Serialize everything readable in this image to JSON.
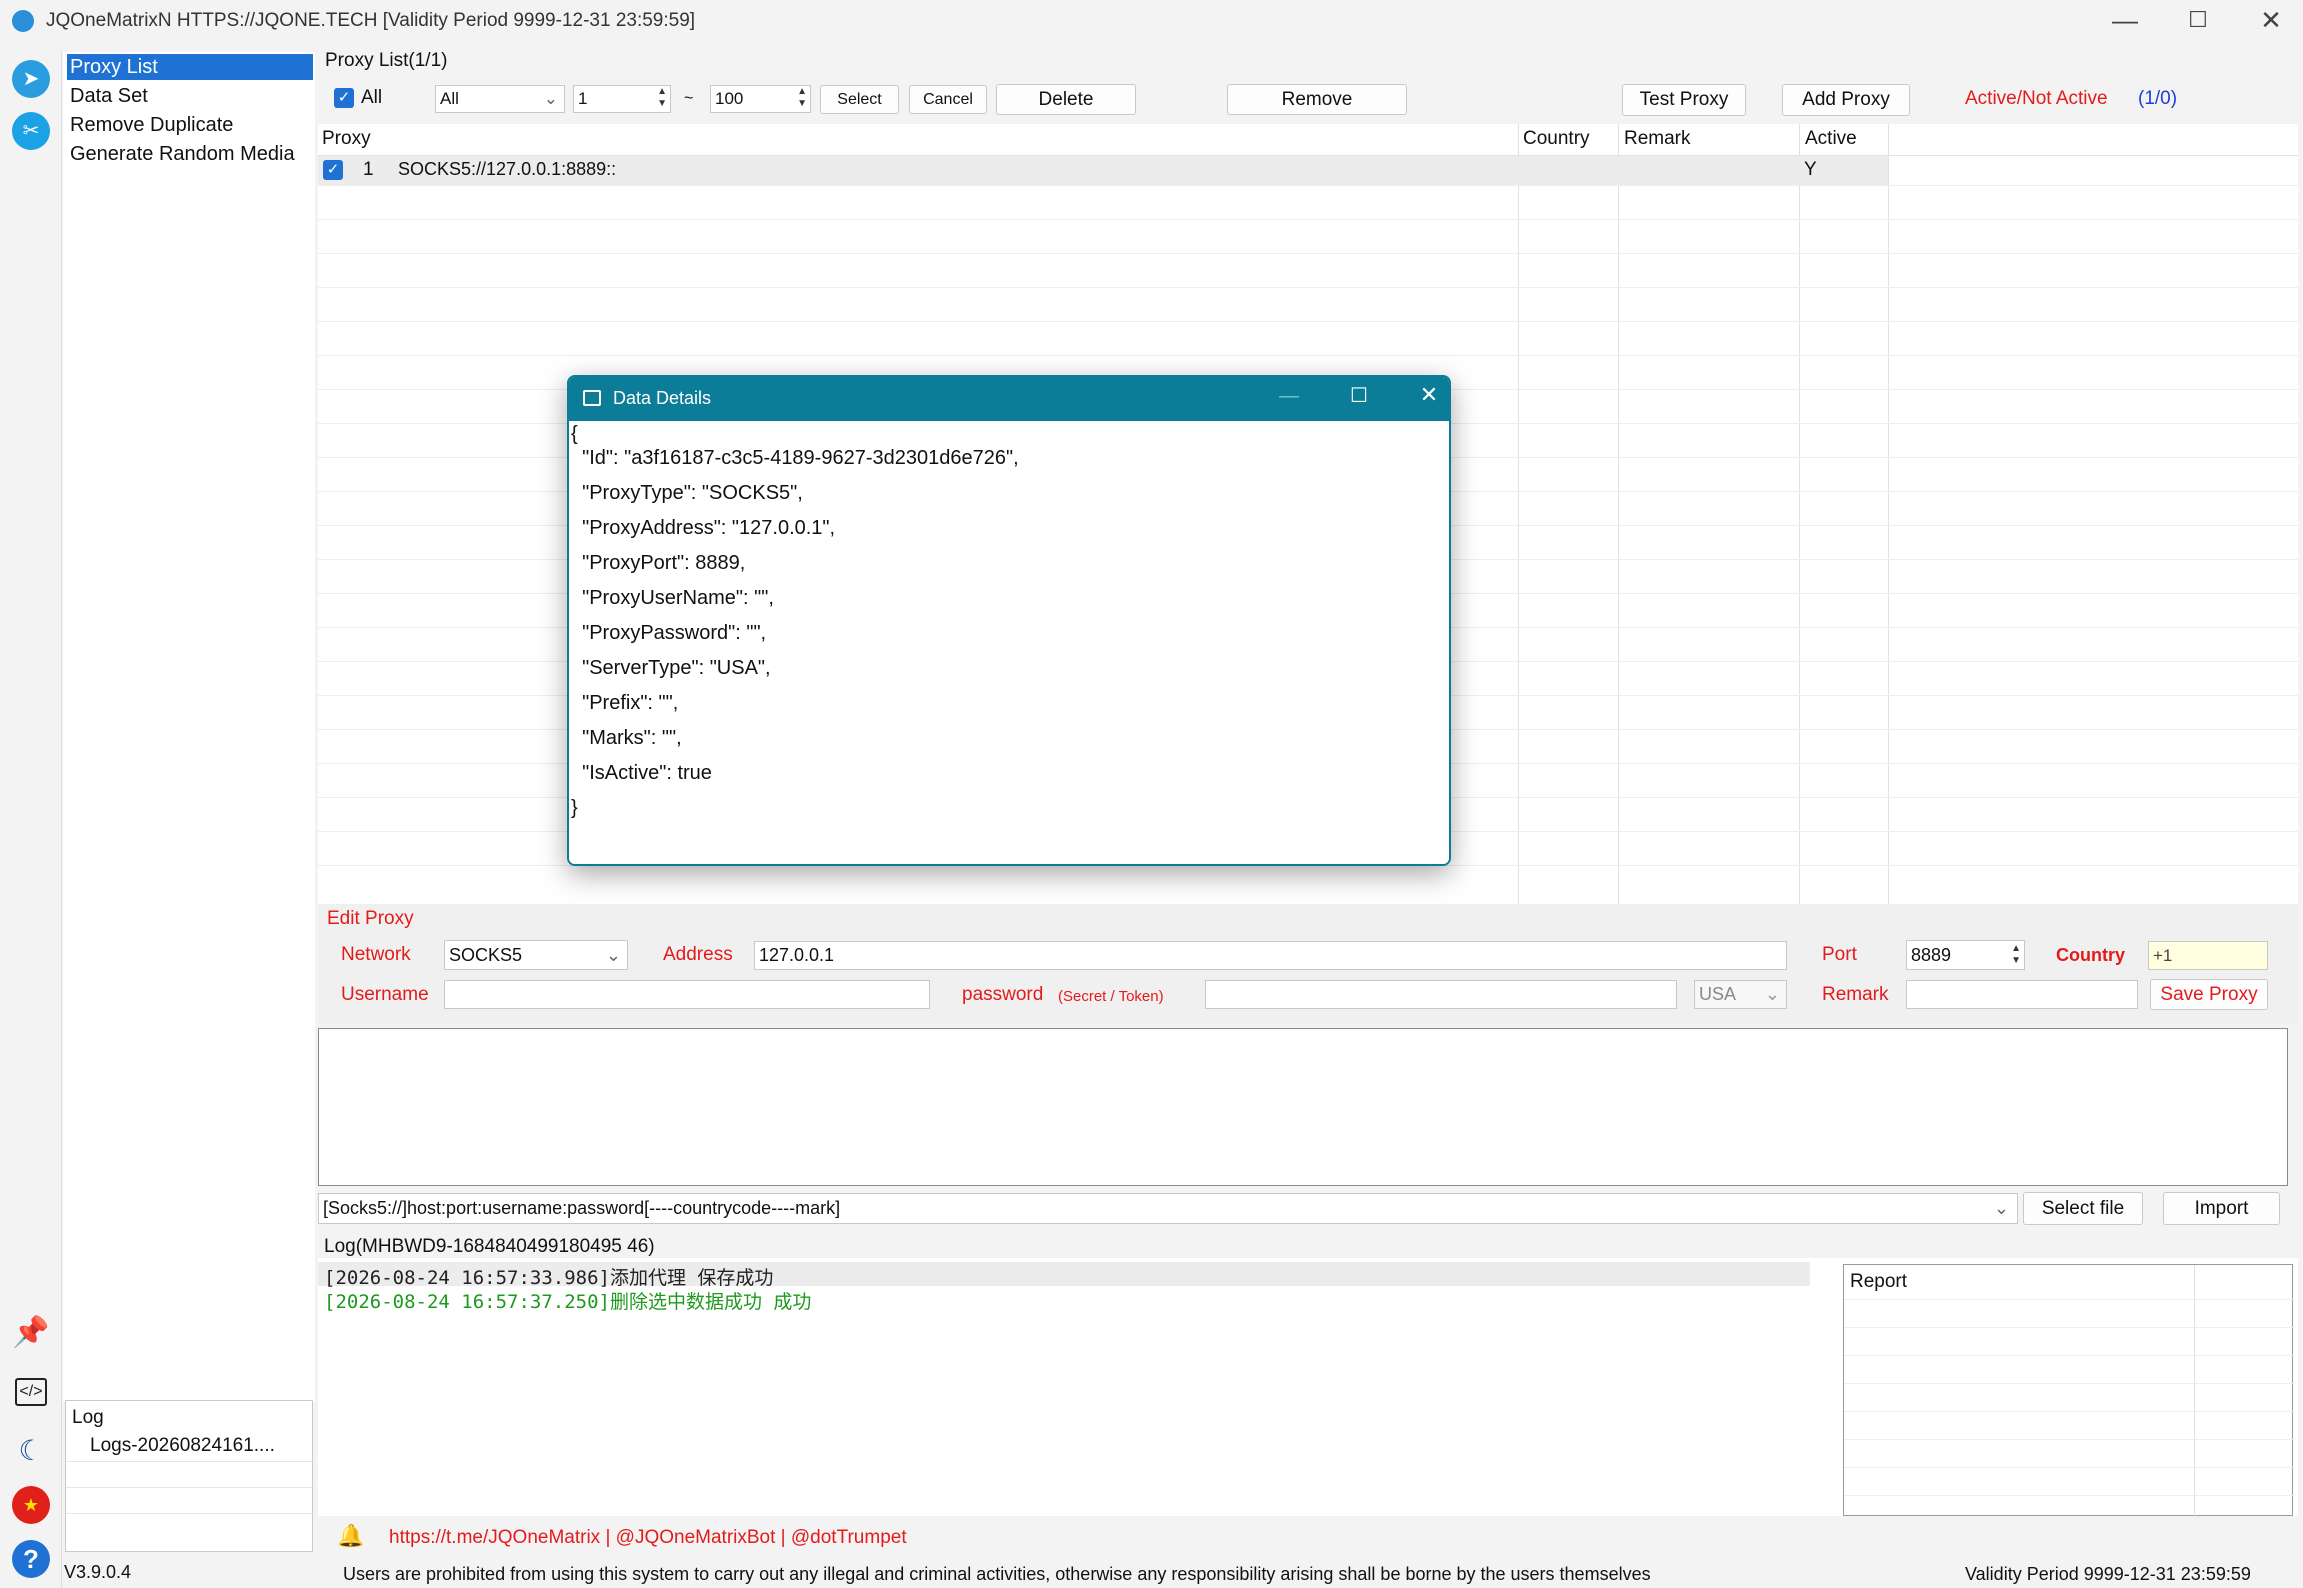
{
  "window": {
    "title": "JQOneMatrixN HTTPS://JQONE.TECH  [Validity Period 9999-12-31 23:59:59]",
    "minimize": "—",
    "maximize": "☐",
    "close": "✕"
  },
  "nav": {
    "items": [
      "Proxy List",
      "Data Set",
      "Remove Duplicate",
      "Generate Random Media"
    ],
    "selected": 0,
    "log_title": "Log",
    "log_file": "Logs-20260824161...."
  },
  "toolbar": {
    "header": "Proxy List(1/1)",
    "all_label": "All",
    "filter_value": "All",
    "range_from": "1",
    "range_sep": "~",
    "range_to": "100",
    "select": "Select",
    "cancel": "Cancel",
    "delete": "Delete",
    "remove": "Remove",
    "test_proxy": "Test Proxy",
    "add_proxy": "Add Proxy",
    "active_label": "Active/Not Active",
    "active_count": "(1/0)",
    "colors": {
      "accent": "#1f72d3",
      "red": "#e31b1b",
      "blue": "#1a3fd6"
    }
  },
  "table": {
    "columns": [
      "Proxy",
      "Country",
      "Remark",
      "Active"
    ],
    "rows": [
      {
        "index": "1",
        "proxy": "SOCKS5://127.0.0.1:8889::",
        "country": "",
        "remark": "",
        "active": "Y",
        "checked": true
      }
    ]
  },
  "dialog": {
    "title": "Data Details",
    "json_lines": [
      "{",
      "  \"Id\": \"a3f16187-c3c5-4189-9627-3d2301d6e726\",",
      "  \"ProxyType\": \"SOCKS5\",",
      "  \"ProxyAddress\": \"127.0.0.1\",",
      "  \"ProxyPort\": 8889,",
      "  \"ProxyUserName\": \"\",",
      "  \"ProxyPassword\": \"\",",
      "  \"ServerType\": \"USA\",",
      "  \"Prefix\": \"\",",
      "  \"Marks\": \"\",",
      "  \"IsActive\": true",
      "}"
    ]
  },
  "edit": {
    "title": "Edit Proxy",
    "network_label": "Network",
    "network_value": "SOCKS5",
    "address_label": "Address",
    "address_value": "127.0.0.1",
    "port_label": "Port",
    "port_value": "8889",
    "country_label": "Country",
    "country_value": "+1",
    "username_label": "Username",
    "username_value": "",
    "password_label": "password",
    "password_hint": "(Secret / Token)",
    "password_value": "",
    "server_value": "USA",
    "remark_label": "Remark",
    "remark_value": "",
    "save": "Save Proxy"
  },
  "import": {
    "format": "[Socks5://]host:port:username:password[----countrycode----mark]",
    "select_file": "Select file",
    "import": "Import"
  },
  "log": {
    "title": "Log(MHBWD9-1684840499180495 46)",
    "lines": [
      {
        "text": "[2026-08-24 16:57:33.986]添加代理 保存成功",
        "color": "#222222"
      },
      {
        "text": "[2026-08-24 16:57:37.250]删除选中数据成功 成功",
        "color": "#1f9a1f"
      }
    ],
    "report_title": "Report"
  },
  "footer": {
    "links": "https://t.me/JQOneMatrix | @JQOneMatrixBot | @dotTrumpet",
    "version": "V3.9.0.4",
    "disclaimer": "Users are prohibited from using this system to carry out any illegal and criminal activities, otherwise any responsibility arising shall be borne by the users themselves",
    "validity": "Validity Period 9999-12-31 23:59:59"
  }
}
